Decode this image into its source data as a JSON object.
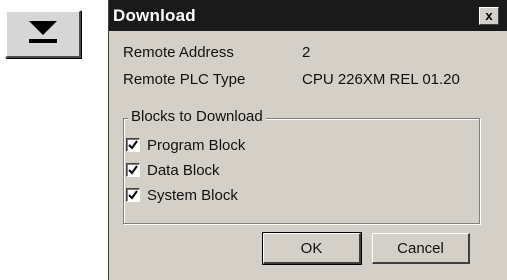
{
  "toolbar": {
    "download_icon": "download-arrow-icon"
  },
  "dialog": {
    "title": "Download",
    "close_label": "x",
    "fields": [
      {
        "label": "Remote Address",
        "value": "2"
      },
      {
        "label": "Remote PLC Type",
        "value": "CPU 226XM REL 01.20"
      }
    ],
    "group": {
      "title": "Blocks to Download",
      "items": [
        {
          "label": "Program Block",
          "checked": true
        },
        {
          "label": "Data Block",
          "checked": true
        },
        {
          "label": "System Block",
          "checked": true
        }
      ]
    },
    "buttons": {
      "ok": "OK",
      "cancel": "Cancel"
    }
  },
  "colors": {
    "titlebar": "#1a1a1a",
    "dialog_bg": "#d4d0c8",
    "toolbar_button_bg": "#d6d6d6"
  }
}
